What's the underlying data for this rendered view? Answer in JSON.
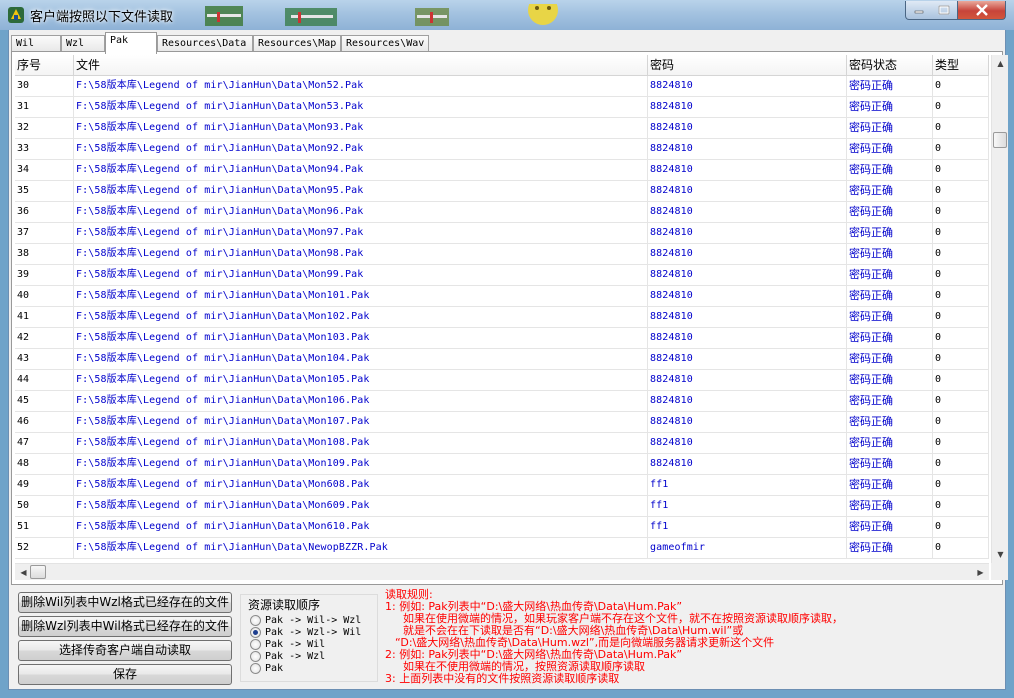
{
  "window": {
    "title": "客户端按照以下文件读取"
  },
  "tabs": [
    "Wil",
    "Wzl",
    "Pak",
    "Resources\\Data",
    "Resources\\Map",
    "Resources\\Wav"
  ],
  "active_tab": "Pak",
  "table": {
    "columns": [
      "序号",
      "文件",
      "密码",
      "密码状态",
      "类型"
    ],
    "rows": [
      [
        "30",
        "F:\\58版本库\\Legend of mir\\JianHun\\Data\\Mon52.Pak",
        "8824810",
        "密码正确",
        "0"
      ],
      [
        "31",
        "F:\\58版本库\\Legend of mir\\JianHun\\Data\\Mon53.Pak",
        "8824810",
        "密码正确",
        "0"
      ],
      [
        "32",
        "F:\\58版本库\\Legend of mir\\JianHun\\Data\\Mon93.Pak",
        "8824810",
        "密码正确",
        "0"
      ],
      [
        "33",
        "F:\\58版本库\\Legend of mir\\JianHun\\Data\\Mon92.Pak",
        "8824810",
        "密码正确",
        "0"
      ],
      [
        "34",
        "F:\\58版本库\\Legend of mir\\JianHun\\Data\\Mon94.Pak",
        "8824810",
        "密码正确",
        "0"
      ],
      [
        "35",
        "F:\\58版本库\\Legend of mir\\JianHun\\Data\\Mon95.Pak",
        "8824810",
        "密码正确",
        "0"
      ],
      [
        "36",
        "F:\\58版本库\\Legend of mir\\JianHun\\Data\\Mon96.Pak",
        "8824810",
        "密码正确",
        "0"
      ],
      [
        "37",
        "F:\\58版本库\\Legend of mir\\JianHun\\Data\\Mon97.Pak",
        "8824810",
        "密码正确",
        "0"
      ],
      [
        "38",
        "F:\\58版本库\\Legend of mir\\JianHun\\Data\\Mon98.Pak",
        "8824810",
        "密码正确",
        "0"
      ],
      [
        "39",
        "F:\\58版本库\\Legend of mir\\JianHun\\Data\\Mon99.Pak",
        "8824810",
        "密码正确",
        "0"
      ],
      [
        "40",
        "F:\\58版本库\\Legend of mir\\JianHun\\Data\\Mon101.Pak",
        "8824810",
        "密码正确",
        "0"
      ],
      [
        "41",
        "F:\\58版本库\\Legend of mir\\JianHun\\Data\\Mon102.Pak",
        "8824810",
        "密码正确",
        "0"
      ],
      [
        "42",
        "F:\\58版本库\\Legend of mir\\JianHun\\Data\\Mon103.Pak",
        "8824810",
        "密码正确",
        "0"
      ],
      [
        "43",
        "F:\\58版本库\\Legend of mir\\JianHun\\Data\\Mon104.Pak",
        "8824810",
        "密码正确",
        "0"
      ],
      [
        "44",
        "F:\\58版本库\\Legend of mir\\JianHun\\Data\\Mon105.Pak",
        "8824810",
        "密码正确",
        "0"
      ],
      [
        "45",
        "F:\\58版本库\\Legend of mir\\JianHun\\Data\\Mon106.Pak",
        "8824810",
        "密码正确",
        "0"
      ],
      [
        "46",
        "F:\\58版本库\\Legend of mir\\JianHun\\Data\\Mon107.Pak",
        "8824810",
        "密码正确",
        "0"
      ],
      [
        "47",
        "F:\\58版本库\\Legend of mir\\JianHun\\Data\\Mon108.Pak",
        "8824810",
        "密码正确",
        "0"
      ],
      [
        "48",
        "F:\\58版本库\\Legend of mir\\JianHun\\Data\\Mon109.Pak",
        "8824810",
        "密码正确",
        "0"
      ],
      [
        "49",
        "F:\\58版本库\\Legend of mir\\JianHun\\Data\\Mon608.Pak",
        "ff1",
        "密码正确",
        "0"
      ],
      [
        "50",
        "F:\\58版本库\\Legend of mir\\JianHun\\Data\\Mon609.Pak",
        "ff1",
        "密码正确",
        "0"
      ],
      [
        "51",
        "F:\\58版本库\\Legend of mir\\JianHun\\Data\\Mon610.Pak",
        "ff1",
        "密码正确",
        "0"
      ],
      [
        "52",
        "F:\\58版本库\\Legend of mir\\JianHun\\Data\\NewopBZZR.Pak",
        "gameofmir",
        "密码正确",
        "0"
      ]
    ]
  },
  "buttons": {
    "delete_wil": "删除Wil列表中Wzl格式已经存在的文件",
    "delete_wzl": "删除Wzl列表中Wil格式已经存在的文件",
    "auto_read": "选择传奇客户端自动读取",
    "save": "保存"
  },
  "read_order": {
    "title": "资源读取顺序",
    "options": [
      "Pak -> Wil-> Wzl",
      "Pak -> Wzl-> Wil",
      "Pak -> Wil",
      "Pak -> Wzl",
      "Pak"
    ],
    "selected_index": 1
  },
  "rules": {
    "lines": [
      "读取规则:",
      "1: 例如: Pak列表中“D:\\盛大网络\\热血传奇\\Data\\Hum.Pak”",
      "如果在使用微端的情况，如果玩家客户端不存在这个文件，就不在按照资源读取顺序读取，",
      "就是不会在在下读取是否有“D:\\盛大网络\\热血传奇\\Data\\Hum.wil”或",
      "“D:\\盛大网络\\热血传奇\\Data\\Hum.wzl”,而是向微端服务器请求更新这个文件",
      "2: 例如: Pak列表中“D:\\盛大网络\\热血传奇\\Data\\Hum.Pak”",
      "如果在不使用微端的情况，按照资源读取顺序读取",
      "3: 上面列表中没有的文件按照资源读取顺序读取"
    ]
  },
  "colors": {
    "link_text": "#0000cc",
    "rules_text": "#ff0000",
    "frame": "#8eb2d6"
  }
}
